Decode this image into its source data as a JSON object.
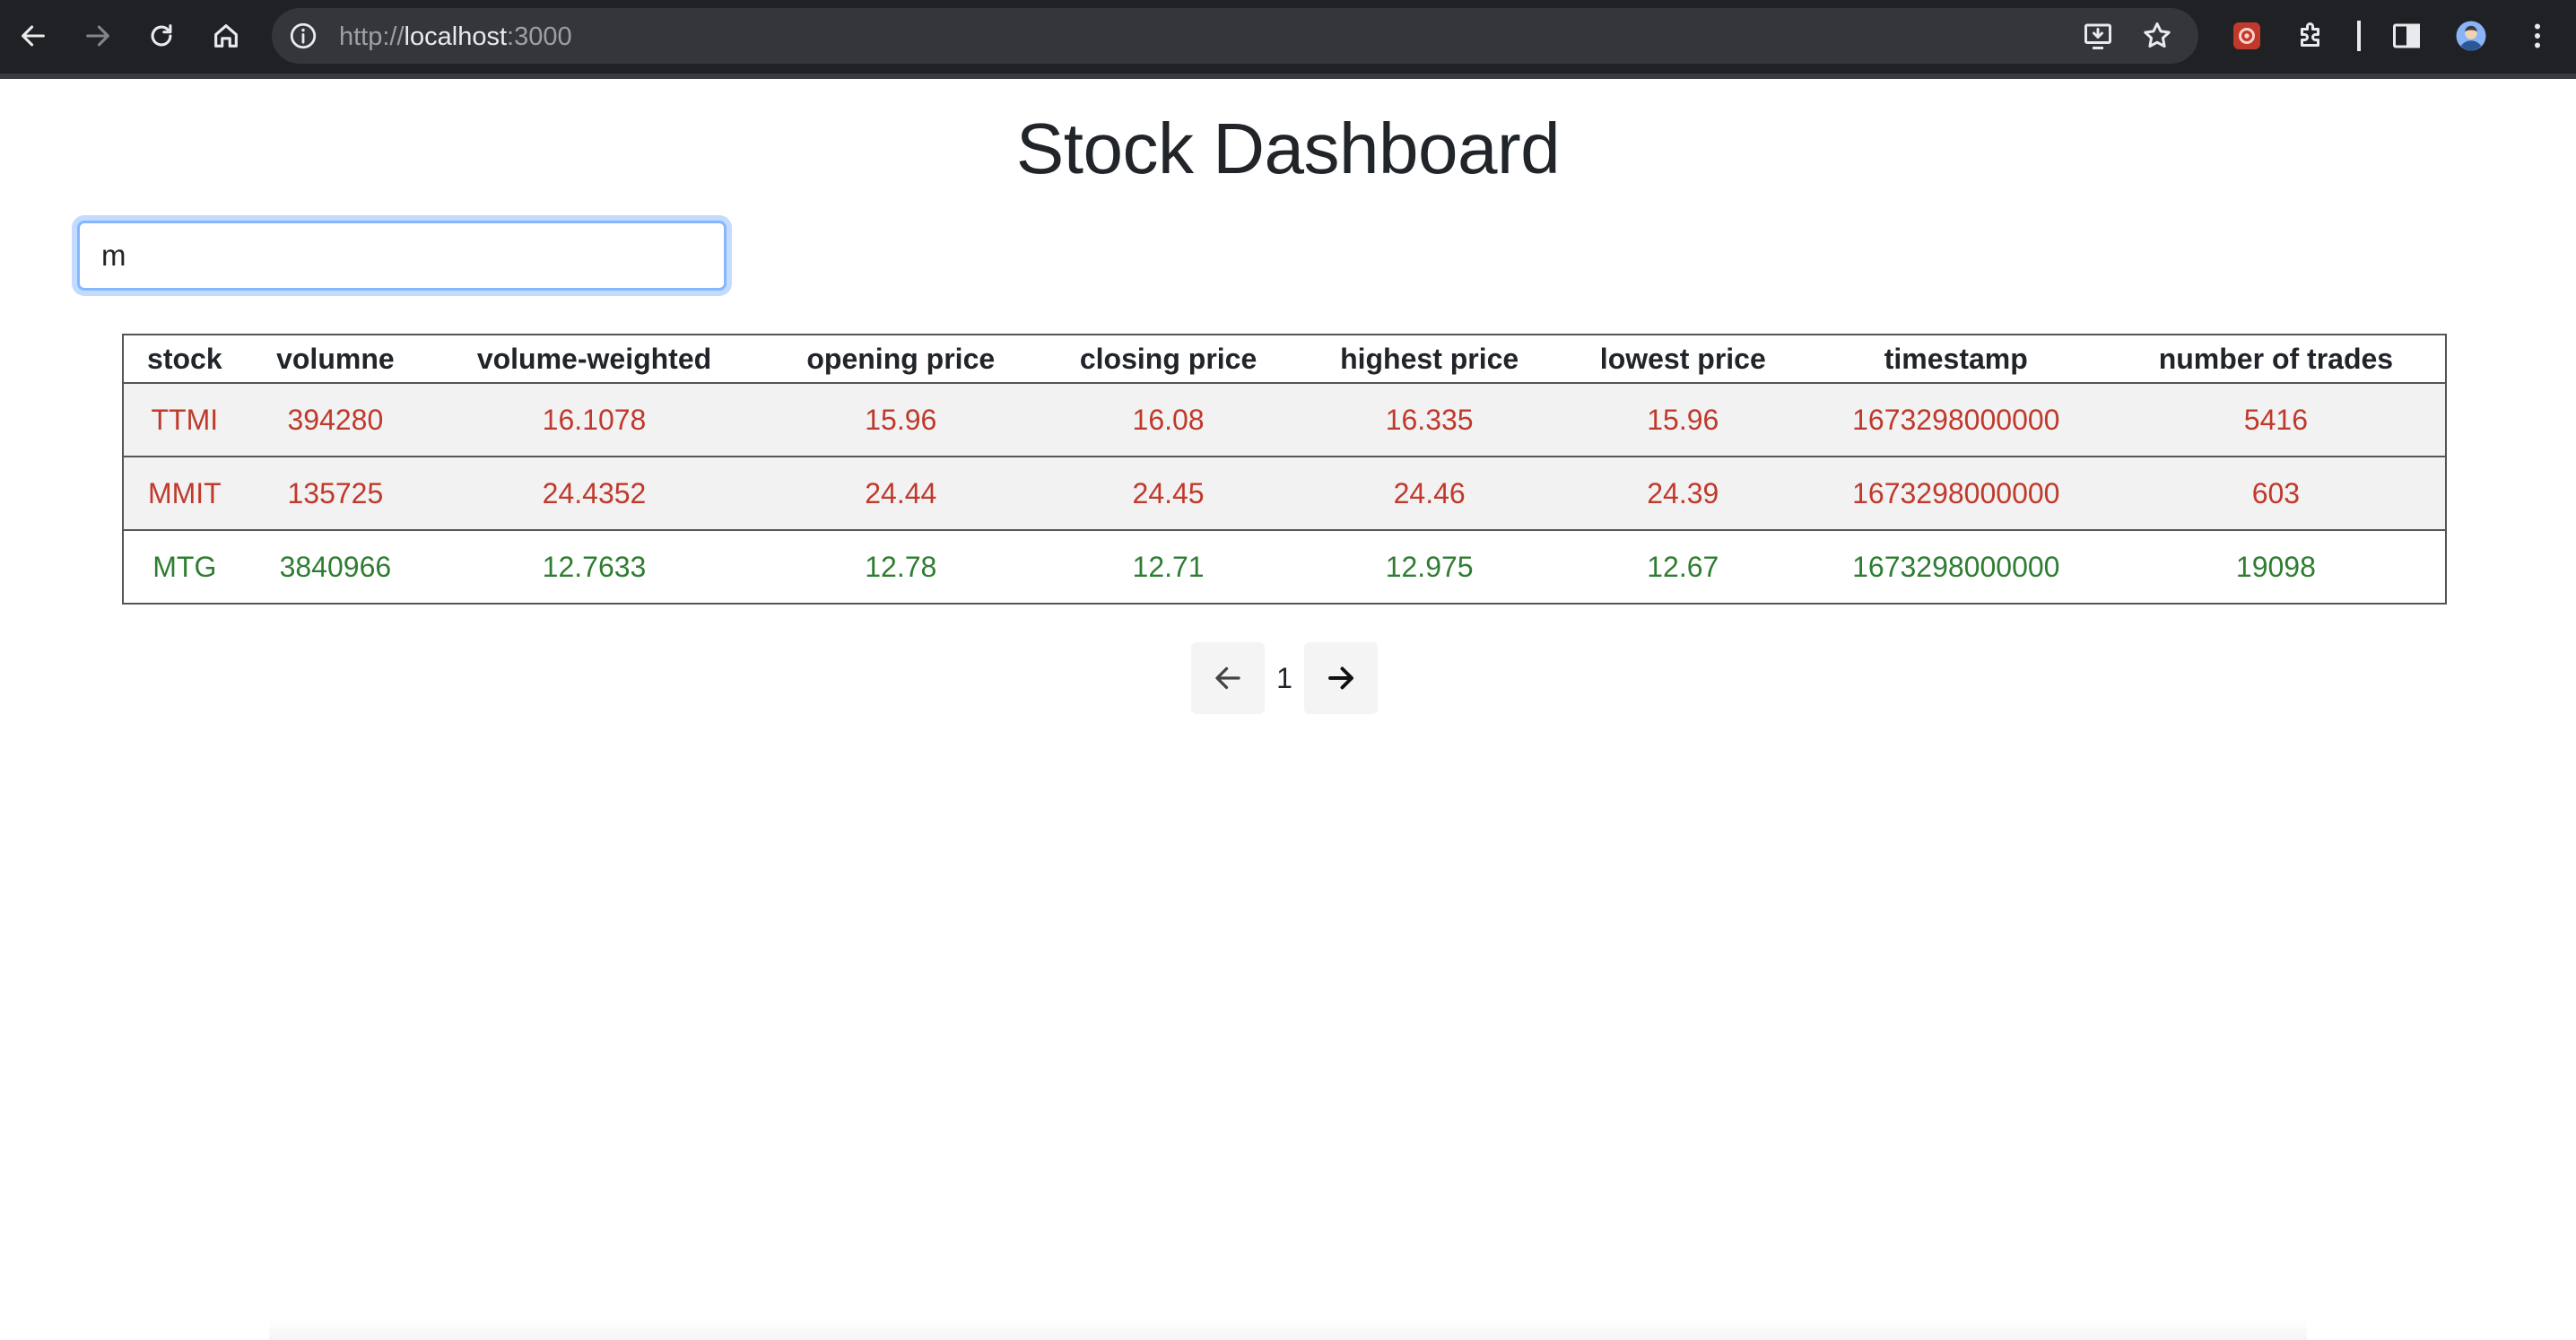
{
  "browser": {
    "url_host": "localhost",
    "url_prefix": "http://",
    "url_port": ":3000",
    "icons": [
      "back-icon",
      "forward-icon",
      "reload-icon",
      "home-icon",
      "info-icon",
      "install-app-icon",
      "bookmark-star-icon",
      "extension-app-icon",
      "extensions-puzzle-icon",
      "side-panel-icon",
      "profile-avatar-icon",
      "more-menu-icon"
    ]
  },
  "page": {
    "title": "Stock Dashboard"
  },
  "search": {
    "value": "m"
  },
  "table": {
    "headers": [
      "stock",
      "volumne",
      "volume-weighted",
      "opening price",
      "closing price",
      "highest price",
      "lowest price",
      "timestamp",
      "number of trades"
    ],
    "rows": [
      [
        "TTMI",
        "394280",
        "16.1078",
        "15.96",
        "16.08",
        "16.335",
        "15.96",
        "1673298000000",
        "5416"
      ],
      [
        "MMIT",
        "135725",
        "24.4352",
        "24.44",
        "24.45",
        "24.46",
        "24.39",
        "1673298000000",
        "603"
      ],
      [
        "MTG",
        "3840966",
        "12.7633",
        "12.78",
        "12.71",
        "12.975",
        "12.67",
        "1673298000000",
        "19098"
      ]
    ],
    "row_trend": [
      "down",
      "down",
      "up"
    ]
  },
  "pagination": {
    "current_page": "1"
  },
  "colors": {
    "down": "#c0392b",
    "up": "#2e7d32",
    "focus_ring": "#86b7fe"
  }
}
